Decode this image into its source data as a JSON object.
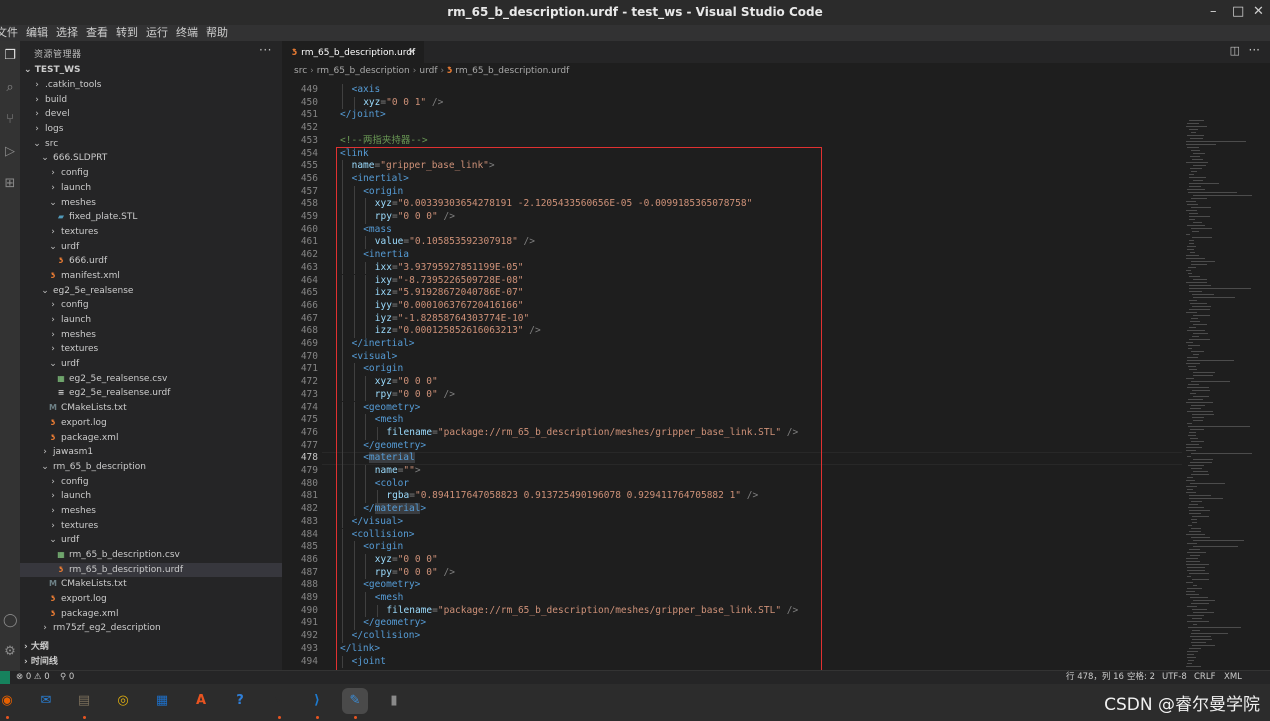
{
  "window": {
    "title": "rm_65_b_description.urdf - test_ws - Visual Studio Code",
    "controls": [
      "–",
      "□",
      "✕"
    ]
  },
  "menu": [
    "文件",
    "编辑",
    "选择",
    "查看",
    "转到",
    "运行",
    "终端",
    "帮助"
  ],
  "sidebar": {
    "header": "资源管理器",
    "more": "···",
    "workspace": "TEST_WS",
    "items": [
      {
        "label": ".catkin_tools",
        "indent": 1,
        "kind": "folder",
        "open": false
      },
      {
        "label": "build",
        "indent": 1,
        "kind": "folder",
        "open": false
      },
      {
        "label": "devel",
        "indent": 1,
        "kind": "folder",
        "open": false
      },
      {
        "label": "logs",
        "indent": 1,
        "kind": "folder",
        "open": false
      },
      {
        "label": "src",
        "indent": 1,
        "kind": "folder",
        "open": true
      },
      {
        "label": "666.SLDPRT",
        "indent": 2,
        "kind": "folder",
        "open": true
      },
      {
        "label": "config",
        "indent": 3,
        "kind": "folder",
        "open": false
      },
      {
        "label": "launch",
        "indent": 3,
        "kind": "folder",
        "open": false
      },
      {
        "label": "meshes",
        "indent": 3,
        "kind": "folder",
        "open": true
      },
      {
        "label": "fixed_plate.STL",
        "indent": 4,
        "kind": "stl"
      },
      {
        "label": "textures",
        "indent": 3,
        "kind": "folder",
        "open": false
      },
      {
        "label": "urdf",
        "indent": 3,
        "kind": "folder",
        "open": true
      },
      {
        "label": "666.urdf",
        "indent": 4,
        "kind": "rss"
      },
      {
        "label": "manifest.xml",
        "indent": 3,
        "kind": "rss"
      },
      {
        "label": "eg2_5e_realsense",
        "indent": 2,
        "kind": "folder",
        "open": true
      },
      {
        "label": "config",
        "indent": 3,
        "kind": "folder",
        "open": false
      },
      {
        "label": "launch",
        "indent": 3,
        "kind": "folder",
        "open": false
      },
      {
        "label": "meshes",
        "indent": 3,
        "kind": "folder",
        "open": false
      },
      {
        "label": "textures",
        "indent": 3,
        "kind": "folder",
        "open": false
      },
      {
        "label": "urdf",
        "indent": 3,
        "kind": "folder",
        "open": true
      },
      {
        "label": "eg2_5e_realsense.csv",
        "indent": 4,
        "kind": "csv"
      },
      {
        "label": "eg2_5e_realsense.urdf",
        "indent": 4,
        "kind": "doc"
      },
      {
        "label": "CMakeLists.txt",
        "indent": 3,
        "kind": "cm"
      },
      {
        "label": "export.log",
        "indent": 3,
        "kind": "rss"
      },
      {
        "label": "package.xml",
        "indent": 3,
        "kind": "rss"
      },
      {
        "label": "jawasm1",
        "indent": 2,
        "kind": "folder",
        "open": false
      },
      {
        "label": "rm_65_b_description",
        "indent": 2,
        "kind": "folder",
        "open": true
      },
      {
        "label": "config",
        "indent": 3,
        "kind": "folder",
        "open": false
      },
      {
        "label": "launch",
        "indent": 3,
        "kind": "folder",
        "open": false
      },
      {
        "label": "meshes",
        "indent": 3,
        "kind": "folder",
        "open": false
      },
      {
        "label": "textures",
        "indent": 3,
        "kind": "folder",
        "open": false
      },
      {
        "label": "urdf",
        "indent": 3,
        "kind": "folder",
        "open": true
      },
      {
        "label": "rm_65_b_description.csv",
        "indent": 4,
        "kind": "csv"
      },
      {
        "label": "rm_65_b_description.urdf",
        "indent": 4,
        "kind": "rss",
        "selected": true
      },
      {
        "label": "CMakeLists.txt",
        "indent": 3,
        "kind": "cm"
      },
      {
        "label": "export.log",
        "indent": 3,
        "kind": "rss"
      },
      {
        "label": "package.xml",
        "indent": 3,
        "kind": "rss"
      },
      {
        "label": "rm75zf_eg2_description",
        "indent": 2,
        "kind": "folder",
        "open": false
      }
    ],
    "outline": "大纲",
    "timeline": "时间线"
  },
  "tab": {
    "label": "rm_65_b_description.urdf",
    "close": "✕"
  },
  "breadcrumb": [
    "src",
    "rm_65_b_description",
    "urdf",
    "rm_65_b_description.urdf"
  ],
  "code": {
    "current_line": 478,
    "lines": [
      {
        "n": 449,
        "indent": 1,
        "parts": [
          [
            "tag",
            "<axis"
          ]
        ]
      },
      {
        "n": 450,
        "indent": 2,
        "parts": [
          [
            "attr",
            "xyz"
          ],
          [
            "pun",
            "="
          ],
          [
            "str",
            "\"0 0 1\""
          ],
          [
            "pun",
            " />"
          ]
        ]
      },
      {
        "n": 451,
        "indent": 0,
        "parts": [
          [
            "tag",
            "</joint>"
          ]
        ]
      },
      {
        "n": 452,
        "indent": 0,
        "parts": []
      },
      {
        "n": 453,
        "indent": 0,
        "parts": [
          [
            "cmt",
            "<!--两指夹持器-->"
          ]
        ]
      },
      {
        "n": 454,
        "indent": 0,
        "parts": [
          [
            "tag",
            "<link"
          ]
        ]
      },
      {
        "n": 455,
        "indent": 1,
        "parts": [
          [
            "attr",
            "name"
          ],
          [
            "pun",
            "="
          ],
          [
            "str",
            "\"gripper_base_link\""
          ],
          [
            "pun",
            ">"
          ]
        ]
      },
      {
        "n": 456,
        "indent": 1,
        "parts": [
          [
            "tag",
            "<inertial>"
          ]
        ]
      },
      {
        "n": 457,
        "indent": 2,
        "parts": [
          [
            "tag",
            "<origin"
          ]
        ]
      },
      {
        "n": 458,
        "indent": 3,
        "parts": [
          [
            "attr",
            "xyz"
          ],
          [
            "pun",
            "="
          ],
          [
            "str",
            "\"0.00339303654278191 -2.1205433560656E-05 -0.0099185365078758\""
          ]
        ]
      },
      {
        "n": 459,
        "indent": 3,
        "parts": [
          [
            "attr",
            "rpy"
          ],
          [
            "pun",
            "="
          ],
          [
            "str",
            "\"0 0 0\""
          ],
          [
            "pun",
            " />"
          ]
        ]
      },
      {
        "n": 460,
        "indent": 2,
        "parts": [
          [
            "tag",
            "<mass"
          ]
        ]
      },
      {
        "n": 461,
        "indent": 3,
        "parts": [
          [
            "attr",
            "value"
          ],
          [
            "pun",
            "="
          ],
          [
            "str",
            "\"0.105853592307918\""
          ],
          [
            "pun",
            " />"
          ]
        ]
      },
      {
        "n": 462,
        "indent": 2,
        "parts": [
          [
            "tag",
            "<inertia"
          ]
        ]
      },
      {
        "n": 463,
        "indent": 3,
        "parts": [
          [
            "attr",
            "ixx"
          ],
          [
            "pun",
            "="
          ],
          [
            "str",
            "\"3.93795927851199E-05\""
          ]
        ]
      },
      {
        "n": 464,
        "indent": 3,
        "parts": [
          [
            "attr",
            "ixy"
          ],
          [
            "pun",
            "="
          ],
          [
            "str",
            "\"-8.7395226509728E-08\""
          ]
        ]
      },
      {
        "n": 465,
        "indent": 3,
        "parts": [
          [
            "attr",
            "ixz"
          ],
          [
            "pun",
            "="
          ],
          [
            "str",
            "\"5.91928672040786E-07\""
          ]
        ]
      },
      {
        "n": 466,
        "indent": 3,
        "parts": [
          [
            "attr",
            "iyy"
          ],
          [
            "pun",
            "="
          ],
          [
            "str",
            "\"0.000106376720416166\""
          ]
        ]
      },
      {
        "n": 467,
        "indent": 3,
        "parts": [
          [
            "attr",
            "iyz"
          ],
          [
            "pun",
            "="
          ],
          [
            "str",
            "\"-1.82858764303774E-10\""
          ]
        ]
      },
      {
        "n": 468,
        "indent": 3,
        "parts": [
          [
            "attr",
            "izz"
          ],
          [
            "pun",
            "="
          ],
          [
            "str",
            "\"0.000125852616063213\""
          ],
          [
            "pun",
            " />"
          ]
        ]
      },
      {
        "n": 469,
        "indent": 1,
        "parts": [
          [
            "tag",
            "</inertial>"
          ]
        ]
      },
      {
        "n": 470,
        "indent": 1,
        "parts": [
          [
            "tag",
            "<visual>"
          ]
        ]
      },
      {
        "n": 471,
        "indent": 2,
        "parts": [
          [
            "tag",
            "<origin"
          ]
        ]
      },
      {
        "n": 472,
        "indent": 3,
        "parts": [
          [
            "attr",
            "xyz"
          ],
          [
            "pun",
            "="
          ],
          [
            "str",
            "\"0 0 0\""
          ]
        ]
      },
      {
        "n": 473,
        "indent": 3,
        "parts": [
          [
            "attr",
            "rpy"
          ],
          [
            "pun",
            "="
          ],
          [
            "str",
            "\"0 0 0\""
          ],
          [
            "pun",
            " />"
          ]
        ]
      },
      {
        "n": 474,
        "indent": 2,
        "parts": [
          [
            "tag",
            "<geometry>"
          ]
        ]
      },
      {
        "n": 475,
        "indent": 3,
        "parts": [
          [
            "tag",
            "<mesh"
          ]
        ]
      },
      {
        "n": 476,
        "indent": 4,
        "parts": [
          [
            "attr",
            "filename"
          ],
          [
            "pun",
            "="
          ],
          [
            "str",
            "\"package://rm_65_b_description/meshes/gripper_base_link.STL\""
          ],
          [
            "pun",
            " />"
          ]
        ]
      },
      {
        "n": 477,
        "indent": 2,
        "parts": [
          [
            "tag",
            "</geometry>"
          ]
        ]
      },
      {
        "n": 478,
        "indent": 2,
        "parts": [
          [
            "tag",
            "<"
          ],
          [
            "taghl",
            "material"
          ]
        ]
      },
      {
        "n": 479,
        "indent": 3,
        "parts": [
          [
            "attr",
            "name"
          ],
          [
            "pun",
            "="
          ],
          [
            "str",
            "\"\""
          ],
          [
            "pun",
            ">"
          ]
        ]
      },
      {
        "n": 480,
        "indent": 3,
        "parts": [
          [
            "tag",
            "<color"
          ]
        ]
      },
      {
        "n": 481,
        "indent": 4,
        "parts": [
          [
            "attr",
            "rgba"
          ],
          [
            "pun",
            "="
          ],
          [
            "str",
            "\"0.894117647058823 0.913725490196078 0.929411764705882 1\""
          ],
          [
            "pun",
            " />"
          ]
        ]
      },
      {
        "n": 482,
        "indent": 2,
        "parts": [
          [
            "tag",
            "</"
          ],
          [
            "taghl",
            "material"
          ],
          [
            "tag",
            ">"
          ]
        ]
      },
      {
        "n": 483,
        "indent": 1,
        "parts": [
          [
            "tag",
            "</visual>"
          ]
        ]
      },
      {
        "n": 484,
        "indent": 1,
        "parts": [
          [
            "tag",
            "<collision>"
          ]
        ]
      },
      {
        "n": 485,
        "indent": 2,
        "parts": [
          [
            "tag",
            "<origin"
          ]
        ]
      },
      {
        "n": 486,
        "indent": 3,
        "parts": [
          [
            "attr",
            "xyz"
          ],
          [
            "pun",
            "="
          ],
          [
            "str",
            "\"0 0 0\""
          ]
        ]
      },
      {
        "n": 487,
        "indent": 3,
        "parts": [
          [
            "attr",
            "rpy"
          ],
          [
            "pun",
            "="
          ],
          [
            "str",
            "\"0 0 0\""
          ],
          [
            "pun",
            " />"
          ]
        ]
      },
      {
        "n": 488,
        "indent": 2,
        "parts": [
          [
            "tag",
            "<geometry>"
          ]
        ]
      },
      {
        "n": 489,
        "indent": 3,
        "parts": [
          [
            "tag",
            "<mesh"
          ]
        ]
      },
      {
        "n": 490,
        "indent": 4,
        "parts": [
          [
            "attr",
            "filename"
          ],
          [
            "pun",
            "="
          ],
          [
            "str",
            "\"package://rm_65_b_description/meshes/gripper_base_link.STL\""
          ],
          [
            "pun",
            " />"
          ]
        ]
      },
      {
        "n": 491,
        "indent": 2,
        "parts": [
          [
            "tag",
            "</geometry>"
          ]
        ]
      },
      {
        "n": 492,
        "indent": 1,
        "parts": [
          [
            "tag",
            "</collision>"
          ]
        ]
      },
      {
        "n": 493,
        "indent": 0,
        "parts": [
          [
            "tag",
            "</link>"
          ]
        ]
      },
      {
        "n": 494,
        "indent": 1,
        "parts": [
          [
            "tag",
            "<joint"
          ]
        ]
      }
    ]
  },
  "status": {
    "problems": "⊗ 0 ⚠ 0",
    "warnings": "⚲ 0",
    "position": "行 478，列 16",
    "spaces": "空格: 2",
    "encoding": "UTF-8",
    "eol": "CRLF",
    "language": "XML"
  },
  "dock": [
    {
      "name": "firefox",
      "glyph": "◉",
      "color": "#e66000"
    },
    {
      "name": "thunderbird",
      "glyph": "✉",
      "color": "#2a7fd4"
    },
    {
      "name": "files",
      "glyph": "▤",
      "color": "#7a6e5a"
    },
    {
      "name": "rhythmbox",
      "glyph": "◎",
      "color": "#e0b010"
    },
    {
      "name": "writer",
      "glyph": "▦",
      "color": "#1e6fc7"
    },
    {
      "name": "software",
      "glyph": "A",
      "color": "#e95420"
    },
    {
      "name": "help",
      "glyph": "?",
      "color": "#2f7fd8"
    },
    {
      "name": "terminal",
      "glyph": ">_",
      "color": "#2c2c2c"
    },
    {
      "name": "vscode",
      "glyph": "⟩",
      "color": "#1e7bd0"
    },
    {
      "name": "text-editor",
      "glyph": "✎",
      "color": "#3c8dd6"
    },
    {
      "name": "usb",
      "glyph": "▮",
      "color": "#8a8a8a"
    }
  ],
  "watermark": "CSDN @睿尔曼学院"
}
